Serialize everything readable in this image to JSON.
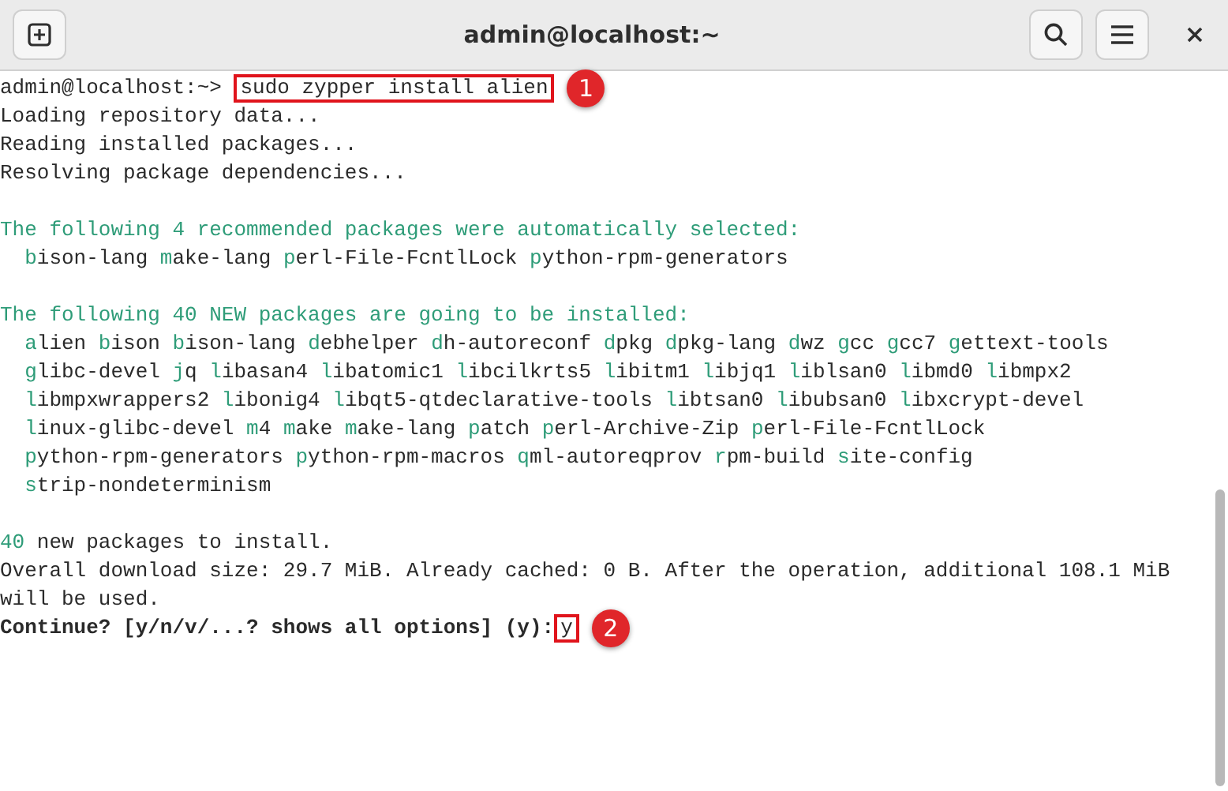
{
  "window": {
    "title": "admin@localhost:~"
  },
  "terminal": {
    "lines": [
      {
        "kind": "prompt",
        "prompt": "admin@localhost:~>",
        "command": "sudo zypper install alien",
        "callout": "1"
      },
      {
        "kind": "plain",
        "text": "Loading repository data..."
      },
      {
        "kind": "plain",
        "text": "Reading installed packages..."
      },
      {
        "kind": "plain",
        "text": "Resolving package dependencies..."
      },
      {
        "kind": "blank"
      },
      {
        "kind": "heading",
        "text": "The following 4 recommended packages were automatically selected:"
      },
      {
        "kind": "packages",
        "packages": [
          "bison-lang",
          "make-lang",
          "perl-File-FcntlLock",
          "python-rpm-generators"
        ]
      },
      {
        "kind": "blank"
      },
      {
        "kind": "heading",
        "text": "The following 40 NEW packages are going to be installed:"
      },
      {
        "kind": "packages",
        "packages": [
          "alien",
          "bison",
          "bison-lang",
          "debhelper",
          "dh-autoreconf",
          "dpkg",
          "dpkg-lang",
          "dwz",
          "gcc",
          "gcc7",
          "gettext-tools"
        ]
      },
      {
        "kind": "packages",
        "packages": [
          "glibc-devel",
          "jq",
          "libasan4",
          "libatomic1",
          "libcilkrts5",
          "libitm1",
          "libjq1",
          "liblsan0",
          "libmd0",
          "libmpx2"
        ]
      },
      {
        "kind": "packages",
        "packages": [
          "libmpxwrappers2",
          "libonig4",
          "libqt5-qtdeclarative-tools",
          "libtsan0",
          "libubsan0",
          "libxcrypt-devel"
        ]
      },
      {
        "kind": "packages",
        "packages": [
          "linux-glibc-devel",
          "m4",
          "make",
          "make-lang",
          "patch",
          "perl-Archive-Zip",
          "perl-File-FcntlLock"
        ]
      },
      {
        "kind": "packages",
        "packages": [
          "python-rpm-generators",
          "python-rpm-macros",
          "qml-autoreqprov",
          "rpm-build",
          "site-config"
        ]
      },
      {
        "kind": "packages",
        "packages": [
          "strip-nondeterminism"
        ]
      },
      {
        "kind": "blank"
      },
      {
        "kind": "count",
        "count": "40",
        "text": "new packages to install."
      },
      {
        "kind": "plain",
        "text": "Overall download size: 29.7 MiB. Already cached: 0 B. After the operation, additional 108.1 MiB"
      },
      {
        "kind": "plain",
        "text": "will be used."
      },
      {
        "kind": "question",
        "text": "Continue? [y/n/v/...? shows all options] (y):",
        "answer": "y",
        "callout": "2"
      }
    ]
  }
}
